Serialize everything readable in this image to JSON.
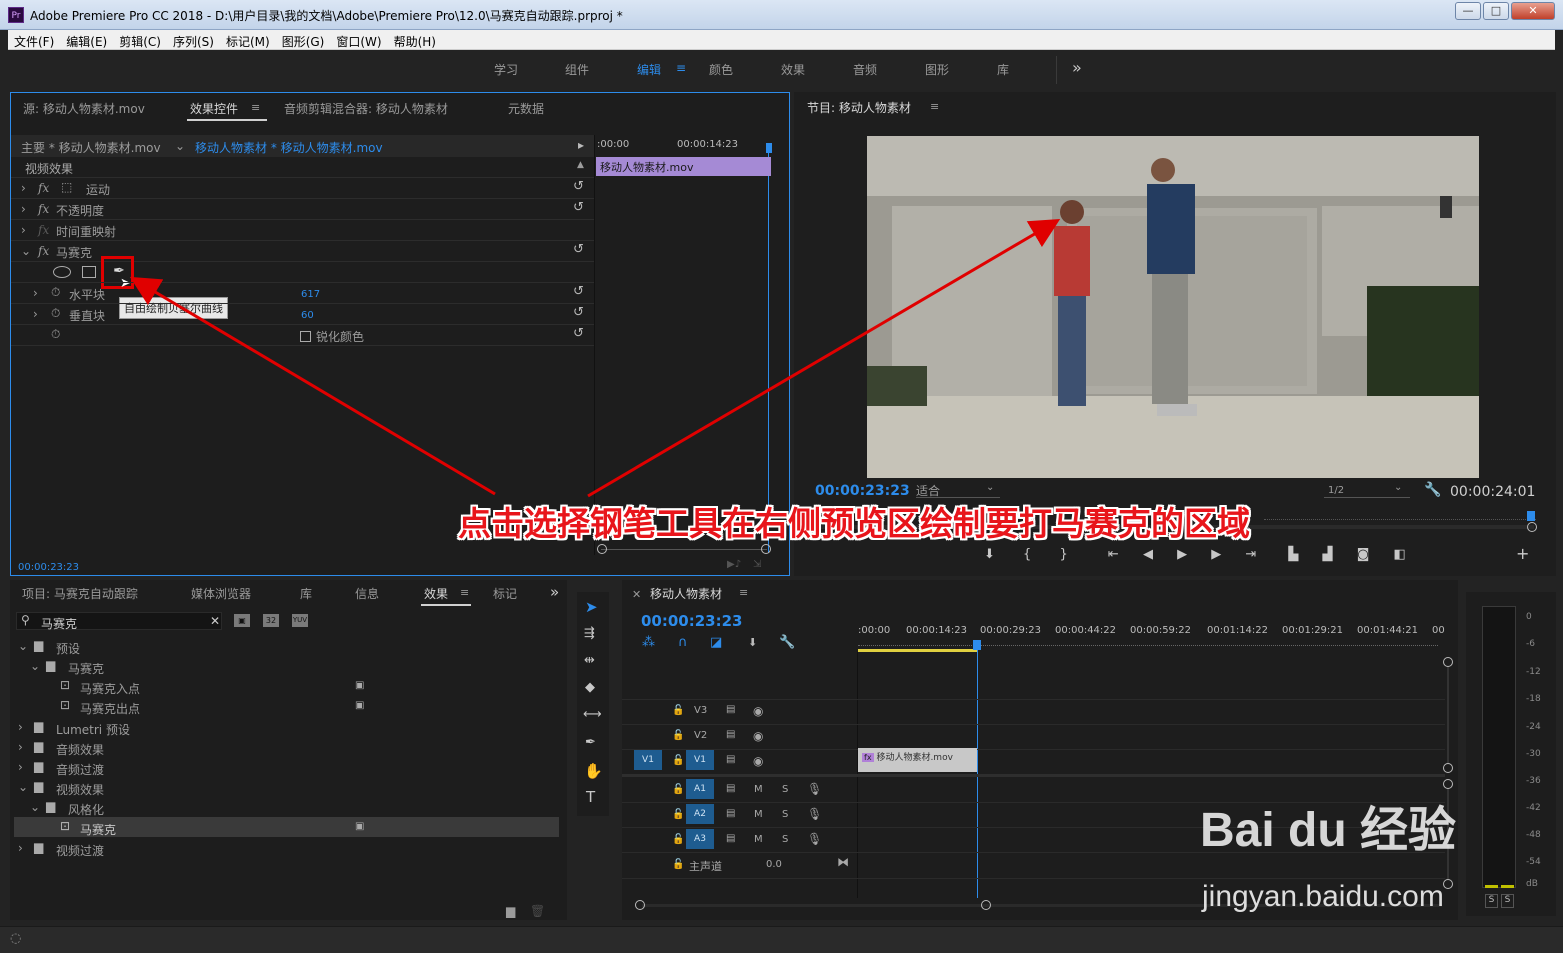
{
  "window": {
    "title": "Adobe Premiere Pro CC 2018 - D:\\用户目录\\我的文档\\Adobe\\Premiere Pro\\12.0\\马赛克自动跟踪.prproj *",
    "logo": "Pr",
    "min": "—",
    "max": "□",
    "close": "✕"
  },
  "menu": [
    "文件(F)",
    "编辑(E)",
    "剪辑(C)",
    "序列(S)",
    "标记(M)",
    "图形(G)",
    "窗口(W)",
    "帮助(H)"
  ],
  "workspaces": {
    "items": [
      "学习",
      "组件",
      "编辑",
      "颜色",
      "效果",
      "音频",
      "图形",
      "库"
    ],
    "active": "编辑",
    "more": "»"
  },
  "effect_panel": {
    "tabs": [
      "源: 移动人物素材.mov",
      "效果控件",
      "音频剪辑混合器: 移动人物素材",
      "元数据"
    ],
    "master": "主要 * 移动人物素材.mov",
    "clip": "移动人物素材 * 移动人物素材.mov",
    "section": "视频效果",
    "effects": [
      {
        "fx": "fx",
        "name": "运动"
      },
      {
        "fx": "fx",
        "name": "不透明度"
      },
      {
        "fx": "fx",
        "name": "时间重映射"
      },
      {
        "fx": "fx",
        "name": "马赛克"
      }
    ],
    "params": [
      {
        "name": "水平块",
        "value": "617"
      },
      {
        "name": "垂直块",
        "value": "60"
      }
    ],
    "sharpen": "锐化颜色",
    "tooltip": "自由绘制贝塞尔曲线",
    "mini_times": [
      ":00:00",
      "00:00:14:23"
    ],
    "mini_clip": "移动人物素材.mov",
    "timecode": "00:00:23:23"
  },
  "program": {
    "title": "节目: 移动人物素材",
    "timecode": "00:00:23:23",
    "fit": "适合",
    "res": "1/2",
    "duration": "00:00:24:01",
    "annotation": "点击选择钢笔工具在右侧预览区绘制要打马赛克的区域"
  },
  "project_panel": {
    "tabs": [
      "项目: 马赛克自动跟踪",
      "媒体浏览器",
      "库",
      "信息",
      "效果",
      "标记"
    ],
    "search": "马赛克",
    "badges": [
      "32",
      "YUV"
    ],
    "tree": [
      {
        "depth": 0,
        "arrow": "⌄",
        "label": "预设"
      },
      {
        "depth": 1,
        "arrow": "⌄",
        "label": "马赛克"
      },
      {
        "depth": 2,
        "arrow": "",
        "label": "马赛克入点"
      },
      {
        "depth": 2,
        "arrow": "",
        "label": "马赛克出点"
      },
      {
        "depth": 0,
        "arrow": "›",
        "label": "Lumetri 预设"
      },
      {
        "depth": 0,
        "arrow": "›",
        "label": "音频效果"
      },
      {
        "depth": 0,
        "arrow": "›",
        "label": "音频过渡"
      },
      {
        "depth": 0,
        "arrow": "⌄",
        "label": "视频效果"
      },
      {
        "depth": 1,
        "arrow": "⌄",
        "label": "风格化"
      },
      {
        "depth": 2,
        "arrow": "",
        "label": "马赛克"
      },
      {
        "depth": 0,
        "arrow": "›",
        "label": "视频过渡"
      }
    ]
  },
  "timeline": {
    "title": "移动人物素材",
    "timecode": "00:00:23:23",
    "ruler": [
      ":00:00",
      "00:00:14:23",
      "00:00:29:23",
      "00:00:44:22",
      "00:00:59:22",
      "00:01:14:22",
      "00:01:29:21",
      "00:01:44:21",
      "00"
    ],
    "tracks_v": [
      "V3",
      "V2",
      "V1"
    ],
    "tracks_a": [
      "A1",
      "A2",
      "A3"
    ],
    "clip": "移动人物素材.mov",
    "master": "主声道",
    "master_val": "0.0",
    "m": "M",
    "s": "S"
  },
  "meter": {
    "labels": [
      "0",
      "-6",
      "-12",
      "-18",
      "-24",
      "-30",
      "-36",
      "-42",
      "-48",
      "-54",
      "dB"
    ],
    "solo": [
      "S",
      "S"
    ]
  },
  "watermark": {
    "brand": "Bai du 经验",
    "url": "jingyan.baidu.com"
  }
}
